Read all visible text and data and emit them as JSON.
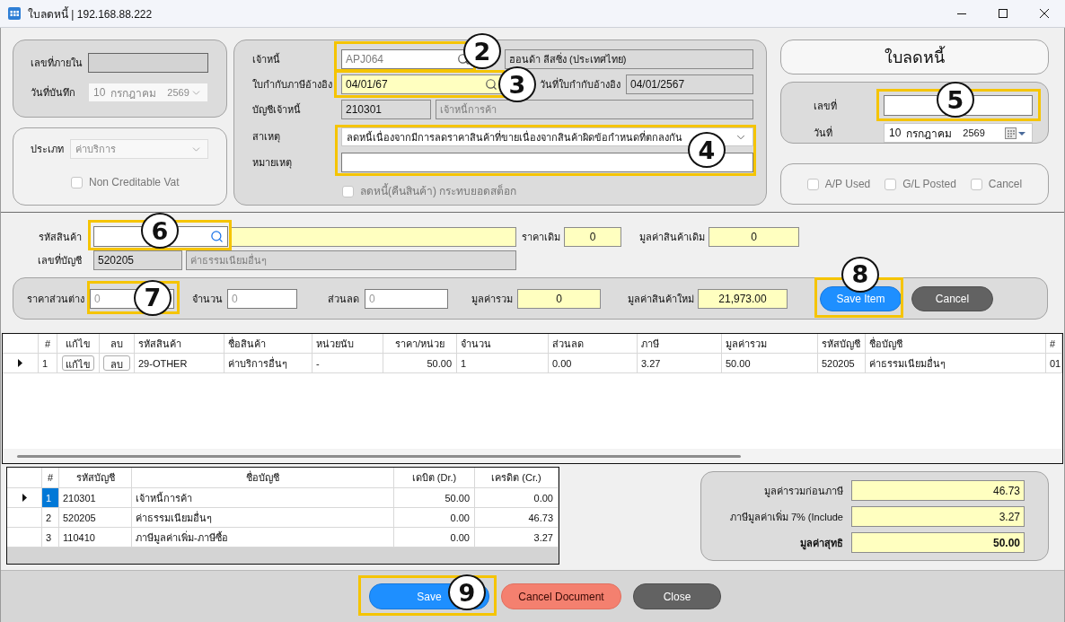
{
  "window": {
    "title": "ใบลดหนี้ | 192.168.88.222"
  },
  "record_panel": {
    "internal_no": {
      "label": "เลขที่ภายใน",
      "disabled": true
    },
    "record_date": {
      "label": "วันที่บันทึก",
      "day": "10",
      "month": "กรกฎาคม",
      "year": "2569",
      "disabled": true
    }
  },
  "type_panel": {
    "type": {
      "label": "ประเภท",
      "value": "ค่าบริการ",
      "disabled": true
    },
    "non_creditable_vat": {
      "label": "Non Creditable Vat",
      "checked": false,
      "disabled": true
    }
  },
  "creditor_panel": {
    "creditor": {
      "label": "เจ้าหนี้",
      "code": "APJ064",
      "name": "ฮอนด้า ลีสซิ่ง (ประเทศไทย)",
      "callout": "2"
    },
    "tax_invoice": {
      "label": "ใบกำกับภาษีอ้างอิง",
      "value": "04/01/67",
      "callout": "3"
    },
    "invoice_date": {
      "label": "วันที่ใบกำกับอ้างอิง",
      "value": "04/01/2567"
    },
    "account": {
      "label": "บัญชีเจ้าหนี้",
      "code": "210301",
      "name": "เจ้าหนี้การค้า"
    },
    "reason": {
      "label": "สาเหตุ",
      "value": "ลดหนี้เนื่องจากมีการลดราคาสินค้าที่ขายเนื่องจากสินค้าผิดข้อกำหนดที่ตกลงกัน"
    },
    "note": {
      "label": "หมายเหตุ"
    },
    "reason_callout": "4",
    "stock_effect": {
      "label": "ลดหนี้(คืนสินค้า) กระทบยอดสต็อก",
      "checked": false,
      "disabled": true
    }
  },
  "document": {
    "title": "ใบลดหนี้",
    "number": {
      "label": "เลขที่",
      "callout": "5"
    },
    "date": {
      "label": "วันที่",
      "day": "10",
      "month": "กรกฎาคม",
      "year": "2569"
    },
    "flags": [
      {
        "label": "A/P Used",
        "checked": false,
        "disabled": true
      },
      {
        "label": "G/L Posted",
        "checked": false,
        "disabled": true
      },
      {
        "label": "Cancel",
        "checked": false,
        "disabled": true
      }
    ]
  },
  "item_editor": {
    "product_code": {
      "label": "รหัสสินค้า",
      "callout": "6"
    },
    "old_price": {
      "label": "ราคาเดิม",
      "value": "0"
    },
    "old_value": {
      "label": "มูลค่าสินค้าเดิม",
      "value": "0"
    },
    "account": {
      "label": "เลขที่บัญชี",
      "code": "520205",
      "name": "ค่าธรรมเนียมอื่นๆ"
    },
    "price_diff": {
      "label": "ราคาส่วนต่าง",
      "placeholder": "0",
      "callout": "7"
    },
    "quantity": {
      "label": "จำนวน",
      "placeholder": "0"
    },
    "discount": {
      "label": "ส่วนลด",
      "placeholder": "0"
    },
    "total": {
      "label": "มูลค่ารวม",
      "value": "0"
    },
    "new_value": {
      "label": "มูลค่าสินค้าใหม่",
      "value": "21,973.00"
    },
    "buttons": [
      {
        "label": "Save Item",
        "kind": "primary",
        "callout": "8"
      },
      {
        "label": "Cancel",
        "kind": "dark"
      }
    ]
  },
  "items_table": {
    "columns": [
      {
        "label": "#",
        "kind": "index"
      },
      {
        "label": "แก้ไข",
        "kind": "button"
      },
      {
        "label": "ลบ",
        "kind": "button"
      },
      {
        "label": "รหัสสินค้า",
        "kind": "text"
      },
      {
        "label": "ชื่อสินค้า",
        "kind": "text"
      },
      {
        "label": "หน่วยนับ",
        "kind": "text"
      },
      {
        "label": "ราคา/หน่วย",
        "kind": "number"
      },
      {
        "label": "จำนวน",
        "kind": "text"
      },
      {
        "label": "ส่วนลด",
        "kind": "text"
      },
      {
        "label": "ภาษี",
        "kind": "text"
      },
      {
        "label": "มูลค่ารวม",
        "kind": "text"
      },
      {
        "label": "รหัสบัญชี",
        "kind": "text"
      },
      {
        "label": "ชื่อบัญชี",
        "kind": "text"
      },
      {
        "label": "#",
        "kind": "text"
      }
    ],
    "rows": [
      {
        "current": true,
        "cells": [
          "1",
          "แก้ไข",
          "ลบ",
          "29-OTHER",
          "ค่าบริการอื่นๆ",
          "-",
          "50.00",
          "1",
          "0.00",
          "3.27",
          "50.00",
          "520205",
          "ค่าธรรมเนียมอื่นๆ",
          "01"
        ]
      }
    ]
  },
  "journal_table": {
    "columns": [
      {
        "label": "#",
        "kind": "index"
      },
      {
        "label": "รหัสบัญชี",
        "kind": "text"
      },
      {
        "label": "ชื่อบัญชี",
        "kind": "text"
      },
      {
        "label": "เดบิต (Dr.)",
        "kind": "number"
      },
      {
        "label": "เครดิต (Cr.)",
        "kind": "number"
      }
    ],
    "rows": [
      {
        "selected": true,
        "cells": [
          "1",
          "210301",
          "เจ้าหนี้การค้า",
          "50.00",
          "0.00"
        ]
      },
      {
        "selected": false,
        "cells": [
          "2",
          "520205",
          "ค่าธรรมเนียมอื่นๆ",
          "0.00",
          "46.73"
        ]
      },
      {
        "selected": false,
        "cells": [
          "3",
          "110410",
          "ภาษีมูลค่าเพิ่ม-ภาษีซื้อ",
          "0.00",
          "3.27"
        ]
      }
    ]
  },
  "totals": [
    {
      "label": "มูลค่ารวมก่อนภาษี",
      "value": "46.73",
      "bold": false
    },
    {
      "label": "ภาษีมูลค่าเพิ่ม 7% (Include",
      "value": "3.27",
      "bold": false
    },
    {
      "label": "มูลค่าสุทธิ",
      "value": "50.00",
      "bold": true
    }
  ],
  "footer_buttons": [
    {
      "label": "Save",
      "kind": "primary",
      "callout": "9"
    },
    {
      "label": "Cancel Document",
      "kind": "danger"
    },
    {
      "label": "Close",
      "kind": "dark"
    }
  ]
}
